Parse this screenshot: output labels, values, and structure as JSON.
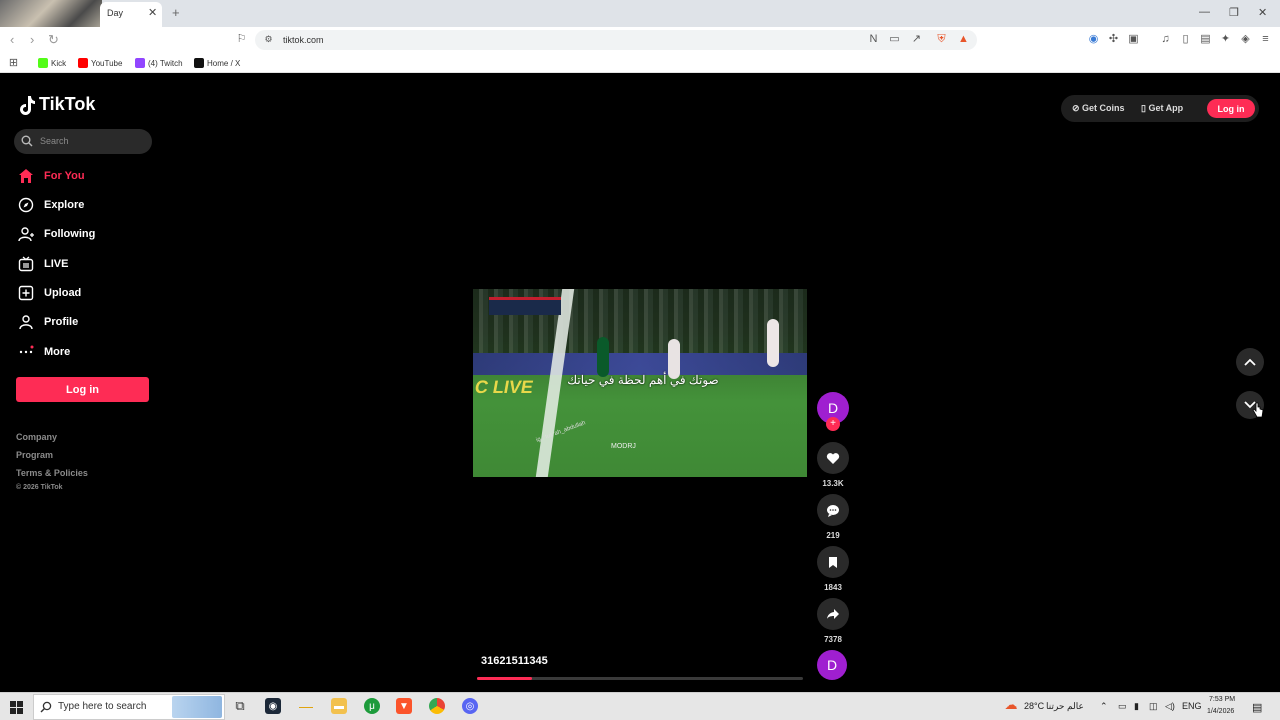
{
  "browser": {
    "tab_title": "Day",
    "tab_close": "✕",
    "new_tab": "+",
    "url": "tiktok.com",
    "window_controls": [
      "—",
      "❐",
      "✕"
    ],
    "bookmarks": [
      {
        "label": "Kick",
        "color": "#53fc18"
      },
      {
        "label": "YouTube",
        "color": "#ff0000"
      },
      {
        "label": "(4) Twitch",
        "color": "#9146ff"
      },
      {
        "label": "Home / X",
        "color": "#111111"
      }
    ]
  },
  "tiktok": {
    "logo": "TikTok",
    "search_placeholder": "Search",
    "nav": [
      {
        "label": "For You",
        "icon": "home-icon",
        "active": true
      },
      {
        "label": "Explore",
        "icon": "compass-icon",
        "active": false
      },
      {
        "label": "Following",
        "icon": "user-plus-icon",
        "active": false
      },
      {
        "label": "LIVE",
        "icon": "live-icon",
        "active": false
      },
      {
        "label": "Upload",
        "icon": "plus-square-icon",
        "active": false
      },
      {
        "label": "Profile",
        "icon": "person-icon",
        "active": false
      },
      {
        "label": "More",
        "icon": "more-icon",
        "active": false
      }
    ],
    "login_label": "Log in",
    "footer": [
      "Company",
      "Program",
      "Terms & Policies",
      "© 2026 TikTok"
    ],
    "top_right": {
      "get_coins": "Get Coins",
      "get_app": "Get App",
      "login": "Log in"
    },
    "video": {
      "subtitle": "صوتك في أهم لحظة في حياتك",
      "live_board": "C LIVE",
      "watermark": "MODRJ",
      "ig_tag": "ig : tuk ah_abdullah"
    },
    "creator_initial": "D",
    "follow_plus": "+",
    "actions": [
      {
        "icon": "heart-icon",
        "count": "13.3K"
      },
      {
        "icon": "comment-icon",
        "count": "219"
      },
      {
        "icon": "bookmark-icon",
        "count": "1843"
      },
      {
        "icon": "share-icon",
        "count": "7378"
      }
    ],
    "username": "31621511345",
    "progress": 0.17,
    "accent": "#fe2c55"
  },
  "taskbar": {
    "search_placeholder": "Type here to search",
    "weather": "28°C",
    "weather_text": "عالم حرتنا",
    "lang": "ENG",
    "time": "7:53 PM",
    "date": "1/4/2026"
  }
}
